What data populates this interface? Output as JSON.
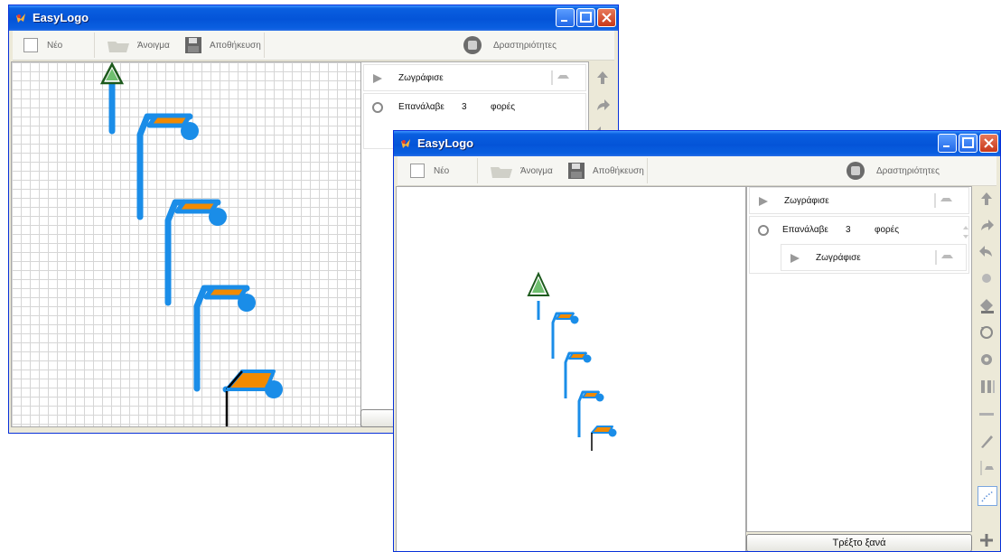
{
  "window_back": {
    "title": "EasyLogo",
    "toolbar": {
      "new_label": "Νέο",
      "open_label": "Άνοιγμα",
      "save_label": "Αποθήκευση",
      "activities_label": "Δραστηριότητες"
    },
    "commands": [
      {
        "label": "Ζωγράφισε"
      },
      {
        "label": "Επανάλαβε",
        "count": "3",
        "unit": "φορές"
      }
    ]
  },
  "window_front": {
    "title": "EasyLogo",
    "toolbar": {
      "new_label": "Νέο",
      "open_label": "Άνοιγμα",
      "save_label": "Αποθήκευση",
      "activities_label": "Δραστηριότητες"
    },
    "commands": [
      {
        "label": "Ζωγράφισε"
      },
      {
        "label": "Επανάλαβε",
        "count": "3",
        "unit": "φορές"
      },
      {
        "label": "Ζωγράφισε"
      }
    ],
    "run_again_label": "Τρέξτο ξανά"
  },
  "colors": {
    "turtle_blue": "#1a8de8",
    "flag_orange": "#f28a00",
    "title_blue": "#0454d8"
  },
  "icons": {
    "palette_icons": [
      "arrow-up-icon",
      "turn-right-icon",
      "turn-left-icon",
      "dot-icon",
      "bucket-icon",
      "repeat-icon",
      "gear-icon",
      "pause-icon",
      "line-width-icon",
      "pen-icon",
      "flag-icon",
      "dotted-path-icon"
    ]
  }
}
